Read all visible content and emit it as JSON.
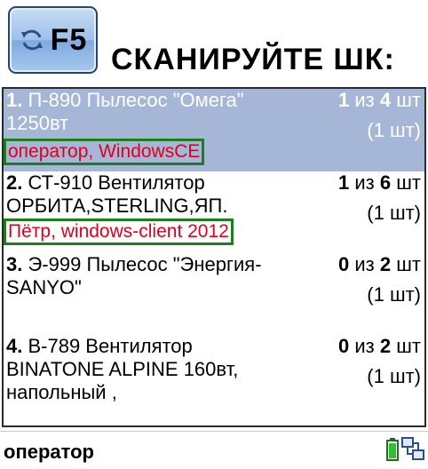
{
  "toolbar": {
    "refresh_key_label": "F5",
    "refresh_icon": "refresh-arrows-icon"
  },
  "header": {
    "title": "СКАНИРУЙТЕ ШК:"
  },
  "items": [
    {
      "number": "1.",
      "name": "П-890 Пылесос \"Омега\" 1250вт",
      "scanned": "1",
      "of": "из",
      "total": "4",
      "unit": "шт",
      "pack": "(1 шт)",
      "user_tag": "оператор, WindowsCE",
      "selected": true
    },
    {
      "number": "2.",
      "name": "СТ-910 Вентилятор ОРБИТА,STERLING,ЯП.",
      "scanned": "1",
      "of": "из",
      "total": "6",
      "unit": "шт",
      "pack": "(1 шт)",
      "user_tag": "Пётр, windows-client 2012",
      "selected": false
    },
    {
      "number": "3.",
      "name": "Э-999 Пылесос \"Энергия-SANYO\"",
      "scanned": "0",
      "of": "из",
      "total": "2",
      "unit": "шт",
      "pack": "(1 шт)",
      "selected": false
    },
    {
      "number": "4.",
      "name": "В-789 Вентилятор BINATONE ALPINE 160вт, напольный ,",
      "scanned": "0",
      "of": "из",
      "total": "2",
      "unit": "шт",
      "pack": "(1 шт)",
      "selected": false
    }
  ],
  "status": {
    "user": "оператор",
    "battery_icon": "battery-icon",
    "network_icon": "network-connection-icon"
  },
  "colors": {
    "selection": "#a6b6d6",
    "user_tag_text": "#e0001e",
    "user_tag_border": "#1e7d1e",
    "button_blue": "#9ec0ea"
  }
}
